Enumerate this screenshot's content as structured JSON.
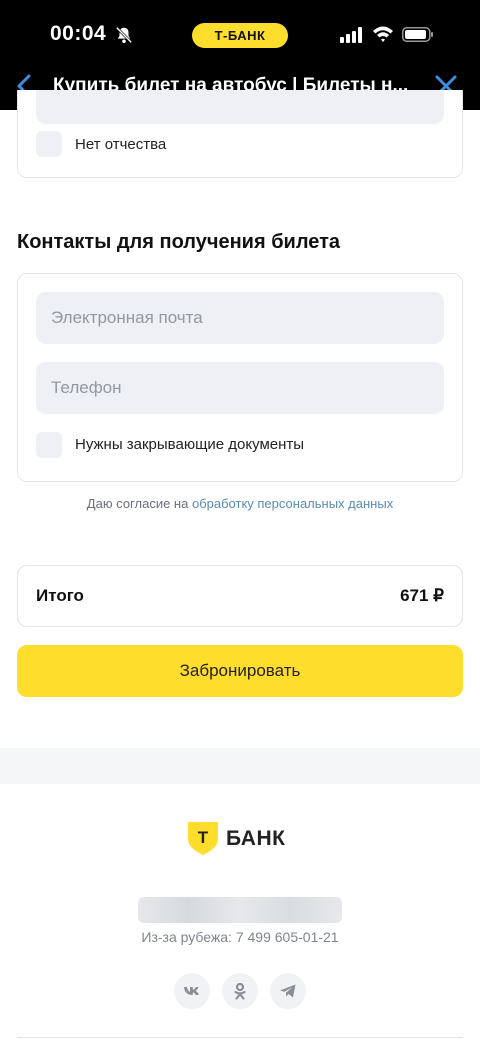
{
  "status_bar": {
    "time": "00:04",
    "pill_label": "Т-БАНК"
  },
  "nav": {
    "title": "Купить билет на автобус | Билеты н..."
  },
  "passenger": {
    "no_patronymic_label": "Нет отчества"
  },
  "contacts": {
    "title": "Контакты для получения билета",
    "email_placeholder": "Электронная почта",
    "phone_placeholder": "Телефон",
    "closing_docs_label": "Нужны закрывающие документы"
  },
  "consent": {
    "prefix": "Даю согласие на",
    "link": "обработку персональных данных"
  },
  "total": {
    "label": "Итого",
    "value": "671 ₽"
  },
  "book_button": "Забронировать",
  "footer": {
    "logo_text": "БАНК",
    "logo_letter": "Т",
    "abroad_phone": "Из-за рубежа: 7 499 605-01-21",
    "social": [
      "vk-icon",
      "ok-icon",
      "telegram-icon"
    ]
  },
  "colors": {
    "brand_yellow": "#ffdd2d",
    "nav_accent": "#3d8ee0",
    "link": "#5a8bb5",
    "field_bg": "#eef0f6"
  }
}
